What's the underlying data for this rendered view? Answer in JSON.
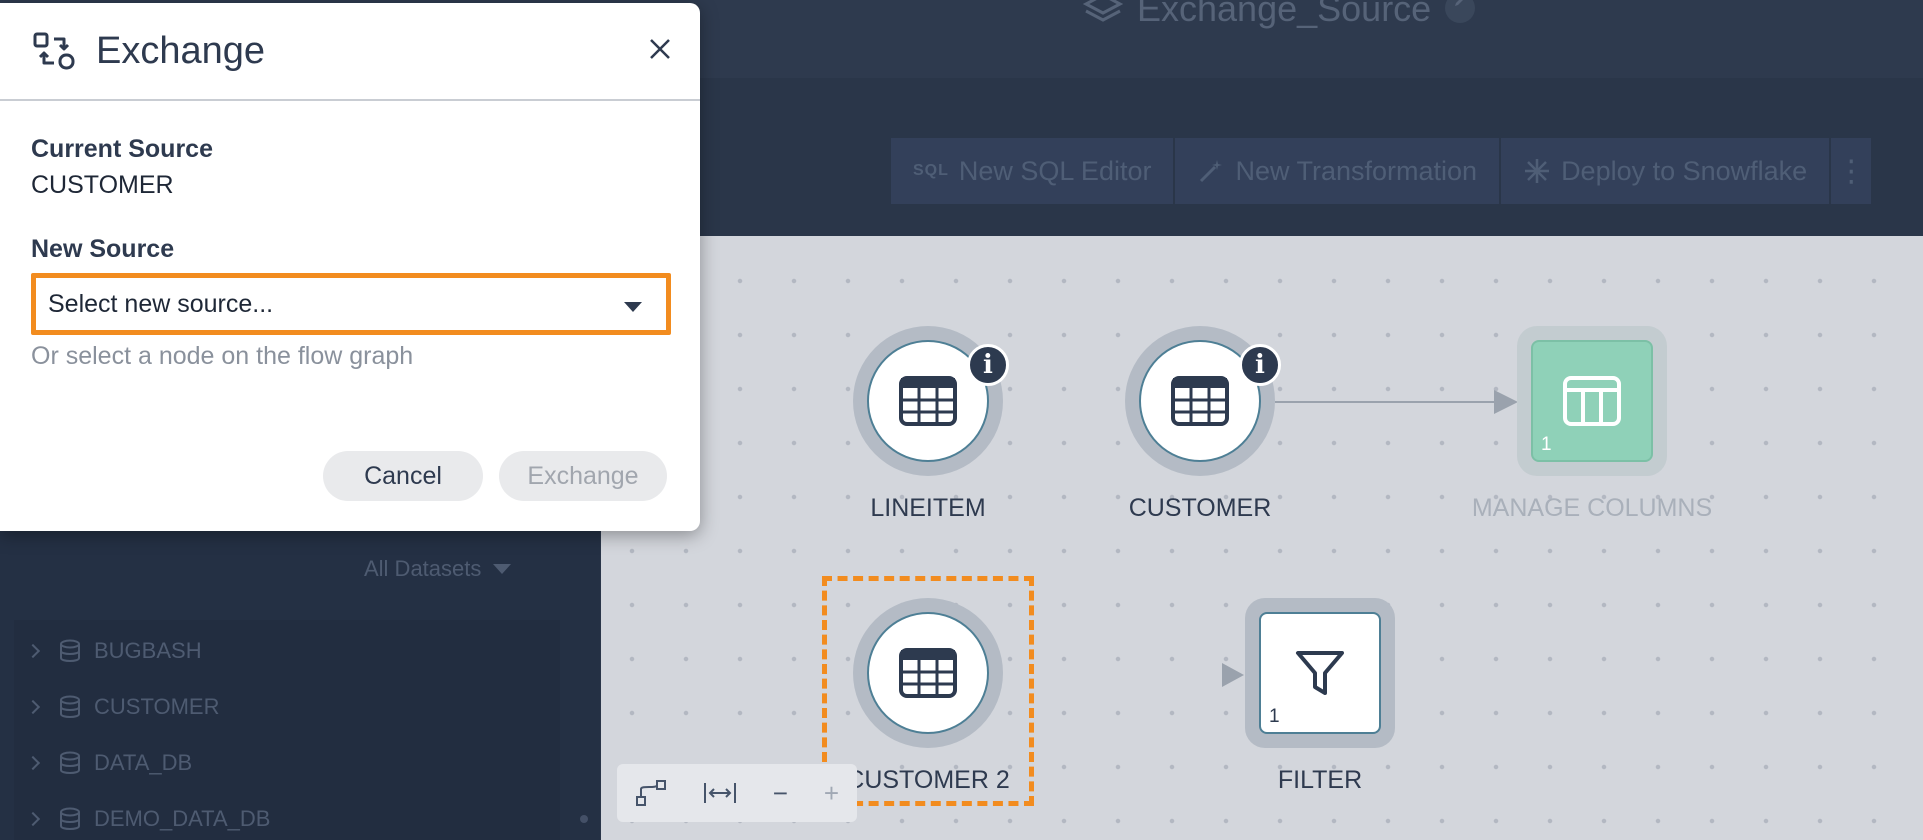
{
  "header": {
    "title": "Exchange_Source"
  },
  "toolbar": {
    "sql_badge": "SQL",
    "new_sql_editor": "New SQL Editor",
    "new_transformation": "New Transformation",
    "deploy": "Deploy to Snowflake",
    "more": "⋮"
  },
  "sidebar": {
    "filter_label": "All Datasets",
    "items": [
      {
        "label": "BUGBASH"
      },
      {
        "label": "CUSTOMER"
      },
      {
        "label": "DATA_DB"
      },
      {
        "label": "DEMO_DATA_DB"
      }
    ]
  },
  "graph": {
    "nodes": [
      {
        "label": "LINEITEM",
        "icon": "table-icon"
      },
      {
        "label": "CUSTOMER",
        "icon": "table-icon"
      },
      {
        "label": "MANAGE COLUMNS",
        "icon": "columns-icon",
        "count": "1"
      },
      {
        "label": "CUSTOMER 2",
        "icon": "table-icon"
      },
      {
        "label": "FILTER",
        "icon": "filter-icon",
        "count": "1"
      }
    ],
    "info_badge": "i"
  },
  "zoom": {
    "minus": "−",
    "plus": "+"
  },
  "modal": {
    "title": "Exchange",
    "current_source_label": "Current Source",
    "current_source_value": "CUSTOMER",
    "new_source_label": "New Source",
    "select_placeholder": "Select new source...",
    "hint": "Or select a node on the flow graph",
    "cancel_label": "Cancel",
    "exchange_label": "Exchange"
  },
  "colors": {
    "accent_orange": "#f28c1f",
    "node_teal": "#8fd1b8",
    "dark_navy": "#2a3649"
  }
}
